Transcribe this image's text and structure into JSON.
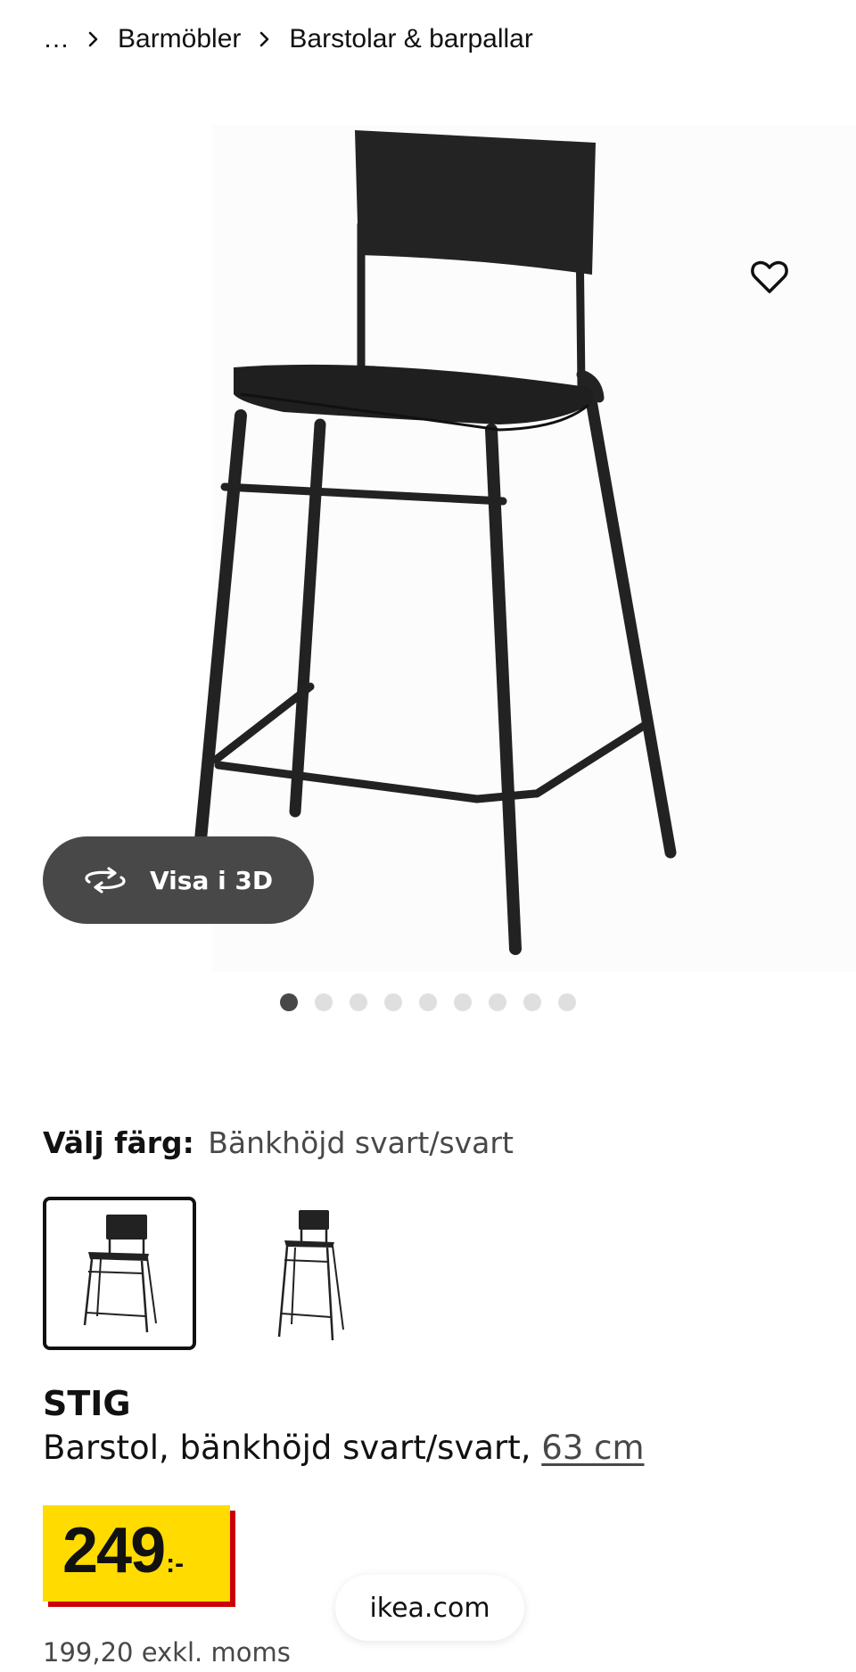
{
  "breadcrumb": {
    "ellipsis": "…",
    "items": [
      "Barmöbler",
      "Barstolar & barpallar"
    ]
  },
  "gallery": {
    "favorite_icon": "heart-outline-icon",
    "view_3d_label": "Visa i 3D",
    "view_3d_icon": "rotate-3d-icon",
    "dot_count": 9,
    "active_dot": 0
  },
  "color_select": {
    "label": "Välj färg:",
    "value": "Bänkhöjd svart/svart",
    "variants": [
      {
        "name": "bankhojd-svart-svart",
        "selected": true
      },
      {
        "name": "barhojd-svart-svart",
        "selected": false
      }
    ]
  },
  "product": {
    "brand": "STIG",
    "description": "Barstol, bänkhöjd svart/svart,",
    "size_link": "63 cm"
  },
  "price": {
    "amount": "249",
    "currency_suffix": ":-",
    "ex_vat": "199,20 exkl. moms"
  },
  "url_pill": {
    "label": "ikea.com"
  },
  "colors": {
    "price_yellow": "#ffdb00",
    "price_red": "#cc0008",
    "button_dark": "#484848",
    "text": "#111111"
  }
}
